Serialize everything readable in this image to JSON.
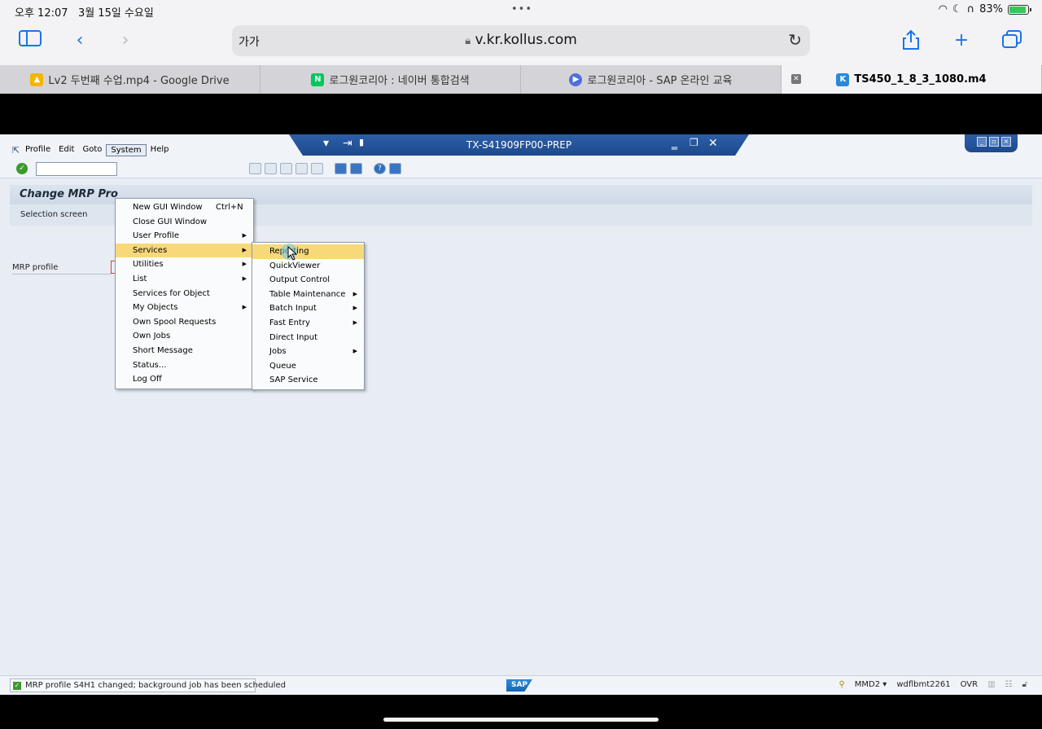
{
  "status_bar": {
    "time": "오후 12:07",
    "date": "3월 15일 수요일",
    "battery": "83%"
  },
  "browser": {
    "text_size": "가가",
    "url": "v.kr.kollus.com",
    "tabs": [
      {
        "label": "Lv2 두번째 수업.mp4 - Google Drive",
        "fav": "drive-icon",
        "color": "#f4b400"
      },
      {
        "label": "로그원코리아 : 네이버 통합검색",
        "fav": "naver-icon",
        "color": "#03c75a"
      },
      {
        "label": "로그원코리아 - SAP 온라인 교육",
        "fav": "play-icon",
        "color": "#4f6fd8"
      },
      {
        "label": "TS450_1_8_3_1080.m4",
        "fav": "kollus-icon",
        "color": "#2b88d8"
      }
    ]
  },
  "sap": {
    "window_title": "TX-S41909FP00-PREP",
    "menu": [
      "Profile",
      "Edit",
      "Goto",
      "System",
      "Help"
    ],
    "screen_title": "Change MRP Pro",
    "subbar": "Selection screen",
    "field_label": "MRP profile",
    "system_menu": [
      {
        "label": "New GUI Window",
        "shortcut": "Ctrl+N",
        "submenu": false
      },
      {
        "label": "Close GUI Window",
        "shortcut": "",
        "submenu": false
      },
      {
        "label": "User Profile",
        "shortcut": "",
        "submenu": true
      },
      {
        "label": "Services",
        "shortcut": "",
        "submenu": true
      },
      {
        "label": "Utilities",
        "shortcut": "",
        "submenu": true
      },
      {
        "label": "List",
        "shortcut": "",
        "submenu": true
      },
      {
        "label": "Services for Object",
        "shortcut": "",
        "submenu": false
      },
      {
        "label": "My Objects",
        "shortcut": "",
        "submenu": true
      },
      {
        "label": "Own Spool Requests",
        "shortcut": "",
        "submenu": false
      },
      {
        "label": "Own Jobs",
        "shortcut": "",
        "submenu": false
      },
      {
        "label": "Short Message",
        "shortcut": "",
        "submenu": false
      },
      {
        "label": "Status...",
        "shortcut": "",
        "submenu": false
      },
      {
        "label": "Log Off",
        "shortcut": "",
        "submenu": false
      }
    ],
    "services_menu": [
      {
        "label": "Reporting",
        "submenu": false
      },
      {
        "label": "QuickViewer",
        "submenu": false
      },
      {
        "label": "Output Control",
        "submenu": false
      },
      {
        "label": "Table Maintenance",
        "submenu": true
      },
      {
        "label": "Batch Input",
        "submenu": true
      },
      {
        "label": "Fast Entry",
        "submenu": true
      },
      {
        "label": "Direct Input",
        "submenu": false
      },
      {
        "label": "Jobs",
        "submenu": true
      },
      {
        "label": "Queue",
        "submenu": false
      },
      {
        "label": "SAP Service",
        "submenu": false
      }
    ],
    "status_message": "MRP profile S4H1 changed; background job has been scheduled",
    "logo": "SAP",
    "status_system": "MMD2",
    "status_host": "wdflbmt2261",
    "status_mode": "OVR"
  }
}
